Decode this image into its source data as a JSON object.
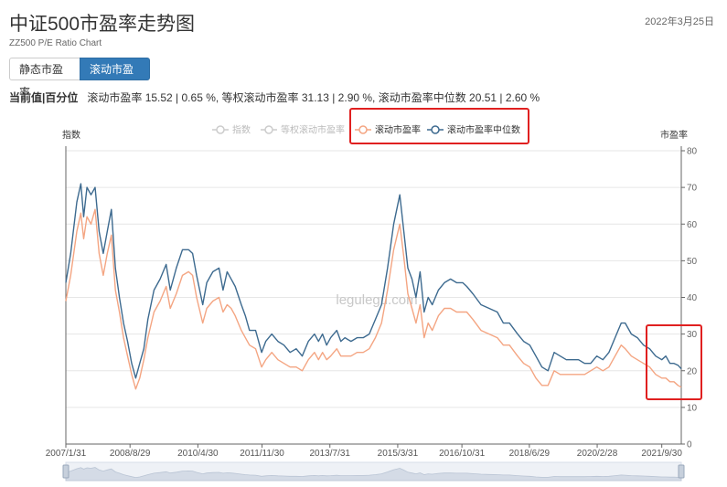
{
  "header": {
    "title": "中证500市盈率走势图",
    "subtitle": "ZZ500 P/E Ratio Chart",
    "date": "2022年3月25日"
  },
  "toggle": {
    "static_label": "静态市盈率",
    "rolling_label": "滚动市盈率",
    "active": "rolling"
  },
  "current": {
    "label": "当前值|百分位",
    "text": "滚动市盈率 15.52 | 0.65 %, 等权滚动市盈率 31.13 | 2.90 %, 滚动市盈率中位数 20.51 | 2.60 %"
  },
  "watermark": "legulegu.com",
  "colors": {
    "rolling_pe": "#f4a582",
    "median_pe": "#3d6a8f",
    "inactive": "#cccccc",
    "highlight_box": "#e02020",
    "grid": "#e6e6e6"
  },
  "chart_data": {
    "type": "line",
    "title": "",
    "ylabel_left": "指数",
    "ylabel_right": "市盈率",
    "ylim": [
      0,
      80
    ],
    "yticks": [
      0,
      10,
      20,
      30,
      40,
      50,
      60,
      70,
      80
    ],
    "xlim": [
      2007.08,
      2022.23
    ],
    "xticks": [
      {
        "label": "2007/1/31",
        "t": 2007.08
      },
      {
        "label": "2008/8/29",
        "t": 2008.66
      },
      {
        "label": "2010/4/30",
        "t": 2010.33
      },
      {
        "label": "2011/11/30",
        "t": 2011.91
      },
      {
        "label": "2013/7/31",
        "t": 2013.58
      },
      {
        "label": "2015/3/31",
        "t": 2015.25
      },
      {
        "label": "2016/10/31",
        "t": 2016.83
      },
      {
        "label": "2018/6/29",
        "t": 2018.49
      },
      {
        "label": "2020/2/28",
        "t": 2020.16
      },
      {
        "label": "2021/9/30",
        "t": 2021.75
      }
    ],
    "legend": [
      {
        "name": "指数",
        "active": false
      },
      {
        "name": "等权滚动市盈率",
        "active": false
      },
      {
        "name": "滚动市盈率",
        "active": true,
        "color": "#f4a582"
      },
      {
        "name": "滚动市盈率中位数",
        "active": true,
        "color": "#3d6a8f"
      }
    ],
    "grid": true,
    "legend_position": "top-center",
    "series": [
      {
        "name": "滚动市盈率中位数",
        "color": "#3d6a8f",
        "points": [
          [
            2007.08,
            44
          ],
          [
            2007.2,
            52
          ],
          [
            2007.35,
            66
          ],
          [
            2007.45,
            71
          ],
          [
            2007.52,
            62
          ],
          [
            2007.6,
            70
          ],
          [
            2007.7,
            68
          ],
          [
            2007.8,
            70
          ],
          [
            2007.9,
            58
          ],
          [
            2008.0,
            52
          ],
          [
            2008.1,
            58
          ],
          [
            2008.2,
            64
          ],
          [
            2008.3,
            48
          ],
          [
            2008.4,
            40
          ],
          [
            2008.5,
            33
          ],
          [
            2008.6,
            28
          ],
          [
            2008.7,
            22
          ],
          [
            2008.8,
            18
          ],
          [
            2008.9,
            22
          ],
          [
            2009.0,
            26
          ],
          [
            2009.1,
            34
          ],
          [
            2009.25,
            42
          ],
          [
            2009.4,
            45
          ],
          [
            2009.55,
            49
          ],
          [
            2009.65,
            42
          ],
          [
            2009.8,
            48
          ],
          [
            2009.95,
            53
          ],
          [
            2010.1,
            53
          ],
          [
            2010.2,
            52
          ],
          [
            2010.3,
            46
          ],
          [
            2010.45,
            38
          ],
          [
            2010.55,
            44
          ],
          [
            2010.7,
            47
          ],
          [
            2010.85,
            48
          ],
          [
            2010.95,
            42
          ],
          [
            2011.05,
            47
          ],
          [
            2011.15,
            45
          ],
          [
            2011.25,
            43
          ],
          [
            2011.4,
            38
          ],
          [
            2011.5,
            35
          ],
          [
            2011.6,
            31
          ],
          [
            2011.75,
            31
          ],
          [
            2011.9,
            25
          ],
          [
            2012.0,
            28
          ],
          [
            2012.15,
            30
          ],
          [
            2012.3,
            28
          ],
          [
            2012.45,
            27
          ],
          [
            2012.6,
            25
          ],
          [
            2012.75,
            26
          ],
          [
            2012.9,
            24
          ],
          [
            2013.05,
            28
          ],
          [
            2013.2,
            30
          ],
          [
            2013.3,
            28
          ],
          [
            2013.4,
            30
          ],
          [
            2013.5,
            27
          ],
          [
            2013.6,
            29
          ],
          [
            2013.75,
            31
          ],
          [
            2013.85,
            28
          ],
          [
            2013.95,
            29
          ],
          [
            2014.1,
            28
          ],
          [
            2014.25,
            29
          ],
          [
            2014.4,
            29
          ],
          [
            2014.55,
            30
          ],
          [
            2014.7,
            34
          ],
          [
            2014.85,
            38
          ],
          [
            2015.0,
            48
          ],
          [
            2015.15,
            60
          ],
          [
            2015.3,
            68
          ],
          [
            2015.4,
            58
          ],
          [
            2015.5,
            48
          ],
          [
            2015.6,
            45
          ],
          [
            2015.7,
            40
          ],
          [
            2015.8,
            47
          ],
          [
            2015.9,
            36
          ],
          [
            2016.0,
            40
          ],
          [
            2016.1,
            38
          ],
          [
            2016.25,
            42
          ],
          [
            2016.4,
            44
          ],
          [
            2016.55,
            45
          ],
          [
            2016.7,
            44
          ],
          [
            2016.85,
            44
          ],
          [
            2016.95,
            43
          ],
          [
            2017.1,
            41
          ],
          [
            2017.3,
            38
          ],
          [
            2017.5,
            37
          ],
          [
            2017.7,
            36
          ],
          [
            2017.85,
            33
          ],
          [
            2018.0,
            33
          ],
          [
            2018.2,
            30
          ],
          [
            2018.35,
            28
          ],
          [
            2018.5,
            27
          ],
          [
            2018.65,
            24
          ],
          [
            2018.8,
            21
          ],
          [
            2018.95,
            20
          ],
          [
            2019.1,
            25
          ],
          [
            2019.25,
            24
          ],
          [
            2019.4,
            23
          ],
          [
            2019.55,
            23
          ],
          [
            2019.7,
            23
          ],
          [
            2019.85,
            22
          ],
          [
            2020.0,
            22
          ],
          [
            2020.15,
            24
          ],
          [
            2020.3,
            23
          ],
          [
            2020.45,
            25
          ],
          [
            2020.6,
            29
          ],
          [
            2020.75,
            33
          ],
          [
            2020.85,
            33
          ],
          [
            2021.0,
            30
          ],
          [
            2021.15,
            29
          ],
          [
            2021.3,
            27
          ],
          [
            2021.45,
            26
          ],
          [
            2021.6,
            24
          ],
          [
            2021.75,
            23
          ],
          [
            2021.85,
            24
          ],
          [
            2021.95,
            22
          ],
          [
            2022.05,
            22
          ],
          [
            2022.15,
            21.5
          ],
          [
            2022.23,
            20.5
          ]
        ]
      },
      {
        "name": "滚动市盈率",
        "color": "#f4a582",
        "points": [
          [
            2007.08,
            39
          ],
          [
            2007.2,
            46
          ],
          [
            2007.35,
            58
          ],
          [
            2007.45,
            63
          ],
          [
            2007.52,
            56
          ],
          [
            2007.6,
            62
          ],
          [
            2007.7,
            60
          ],
          [
            2007.8,
            64
          ],
          [
            2007.9,
            52
          ],
          [
            2008.0,
            46
          ],
          [
            2008.1,
            52
          ],
          [
            2008.2,
            57
          ],
          [
            2008.3,
            42
          ],
          [
            2008.4,
            36
          ],
          [
            2008.5,
            29
          ],
          [
            2008.6,
            24
          ],
          [
            2008.7,
            19
          ],
          [
            2008.8,
            15
          ],
          [
            2008.9,
            18
          ],
          [
            2009.0,
            23
          ],
          [
            2009.1,
            29
          ],
          [
            2009.25,
            36
          ],
          [
            2009.4,
            39
          ],
          [
            2009.55,
            43
          ],
          [
            2009.65,
            37
          ],
          [
            2009.8,
            41
          ],
          [
            2009.95,
            46
          ],
          [
            2010.1,
            47
          ],
          [
            2010.2,
            46
          ],
          [
            2010.3,
            40
          ],
          [
            2010.45,
            33
          ],
          [
            2010.55,
            37
          ],
          [
            2010.7,
            39
          ],
          [
            2010.85,
            40
          ],
          [
            2010.95,
            36
          ],
          [
            2011.05,
            38
          ],
          [
            2011.15,
            37
          ],
          [
            2011.25,
            35
          ],
          [
            2011.4,
            31
          ],
          [
            2011.5,
            29
          ],
          [
            2011.6,
            27
          ],
          [
            2011.75,
            26
          ],
          [
            2011.9,
            21
          ],
          [
            2012.0,
            23
          ],
          [
            2012.15,
            25
          ],
          [
            2012.3,
            23
          ],
          [
            2012.45,
            22
          ],
          [
            2012.6,
            21
          ],
          [
            2012.75,
            21
          ],
          [
            2012.9,
            20
          ],
          [
            2013.05,
            23
          ],
          [
            2013.2,
            25
          ],
          [
            2013.3,
            23
          ],
          [
            2013.4,
            25
          ],
          [
            2013.5,
            23
          ],
          [
            2013.6,
            24
          ],
          [
            2013.75,
            26
          ],
          [
            2013.85,
            24
          ],
          [
            2013.95,
            24
          ],
          [
            2014.1,
            24
          ],
          [
            2014.25,
            25
          ],
          [
            2014.4,
            25
          ],
          [
            2014.55,
            26
          ],
          [
            2014.7,
            29
          ],
          [
            2014.85,
            33
          ],
          [
            2015.0,
            42
          ],
          [
            2015.15,
            53
          ],
          [
            2015.3,
            60
          ],
          [
            2015.4,
            51
          ],
          [
            2015.5,
            41
          ],
          [
            2015.6,
            37
          ],
          [
            2015.7,
            33
          ],
          [
            2015.8,
            38
          ],
          [
            2015.9,
            29
          ],
          [
            2016.0,
            33
          ],
          [
            2016.1,
            31
          ],
          [
            2016.25,
            35
          ],
          [
            2016.4,
            37
          ],
          [
            2016.55,
            37
          ],
          [
            2016.7,
            36
          ],
          [
            2016.85,
            36
          ],
          [
            2016.95,
            36
          ],
          [
            2017.1,
            34
          ],
          [
            2017.3,
            31
          ],
          [
            2017.5,
            30
          ],
          [
            2017.7,
            29
          ],
          [
            2017.85,
            27
          ],
          [
            2018.0,
            27
          ],
          [
            2018.2,
            24
          ],
          [
            2018.35,
            22
          ],
          [
            2018.5,
            21
          ],
          [
            2018.65,
            18
          ],
          [
            2018.8,
            16
          ],
          [
            2018.95,
            16
          ],
          [
            2019.1,
            20
          ],
          [
            2019.25,
            19
          ],
          [
            2019.4,
            19
          ],
          [
            2019.55,
            19
          ],
          [
            2019.7,
            19
          ],
          [
            2019.85,
            19
          ],
          [
            2020.0,
            20
          ],
          [
            2020.15,
            21
          ],
          [
            2020.3,
            20
          ],
          [
            2020.45,
            21
          ],
          [
            2020.6,
            24
          ],
          [
            2020.75,
            27
          ],
          [
            2020.85,
            26
          ],
          [
            2021.0,
            24
          ],
          [
            2021.15,
            23
          ],
          [
            2021.3,
            22
          ],
          [
            2021.45,
            21
          ],
          [
            2021.6,
            19
          ],
          [
            2021.75,
            18
          ],
          [
            2021.85,
            18
          ],
          [
            2021.95,
            17
          ],
          [
            2022.05,
            17
          ],
          [
            2022.15,
            16
          ],
          [
            2022.23,
            15.5
          ]
        ]
      }
    ]
  }
}
